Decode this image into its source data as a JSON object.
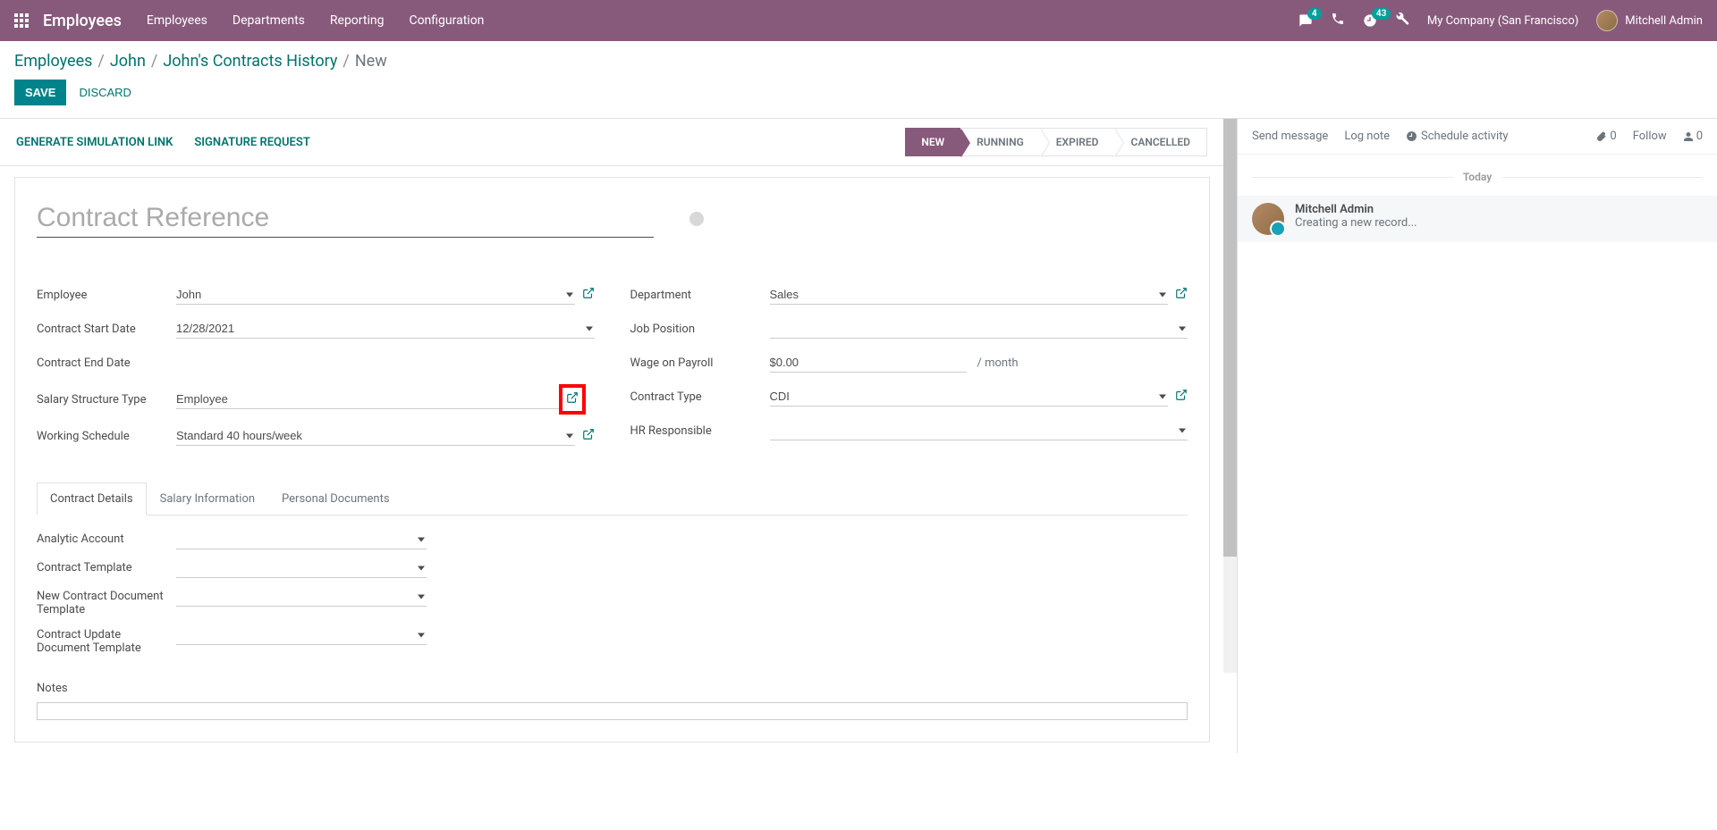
{
  "topbar": {
    "app_title": "Employees",
    "menu": [
      "Employees",
      "Departments",
      "Reporting",
      "Configuration"
    ],
    "chat_badge": "4",
    "activity_badge": "43",
    "company": "My Company (San Francisco)",
    "user": "Mitchell Admin"
  },
  "breadcrumb": {
    "items": [
      "Employees",
      "John",
      "John's Contracts History"
    ],
    "current": "New"
  },
  "actions": {
    "save": "SAVE",
    "discard": "DISCARD"
  },
  "statusbar": {
    "actions": [
      "GENERATE SIMULATION LINK",
      "SIGNATURE REQUEST"
    ],
    "steps": [
      "NEW",
      "RUNNING",
      "EXPIRED",
      "CANCELLED"
    ]
  },
  "form": {
    "title_placeholder": "Contract Reference",
    "labels": {
      "employee": "Employee",
      "start_date": "Contract Start Date",
      "end_date": "Contract End Date",
      "salary_structure": "Salary Structure Type",
      "working_schedule": "Working Schedule",
      "department": "Department",
      "job_position": "Job Position",
      "wage": "Wage on Payroll",
      "contract_type": "Contract Type",
      "hr_responsible": "HR Responsible"
    },
    "values": {
      "employee": "John",
      "start_date": "12/28/2021",
      "end_date": "",
      "salary_structure": "Employee",
      "working_schedule": "Standard 40 hours/week",
      "department": "Sales",
      "job_position": "",
      "wage": "$0.00",
      "wage_suffix": "/ month",
      "contract_type": "CDI",
      "hr_responsible": ""
    }
  },
  "tabs": [
    "Contract Details",
    "Salary Information",
    "Personal Documents"
  ],
  "details": {
    "labels": {
      "analytic": "Analytic Account",
      "template": "Contract Template",
      "new_doc": "New Contract Document Template",
      "update_doc": "Contract Update Document Template",
      "notes": "Notes"
    }
  },
  "chatter": {
    "send": "Send message",
    "log": "Log note",
    "schedule": "Schedule activity",
    "attach_count": "0",
    "follow": "Follow",
    "follower_count": "0",
    "divider": "Today",
    "message": {
      "author": "Mitchell Admin",
      "text": "Creating a new record..."
    }
  }
}
